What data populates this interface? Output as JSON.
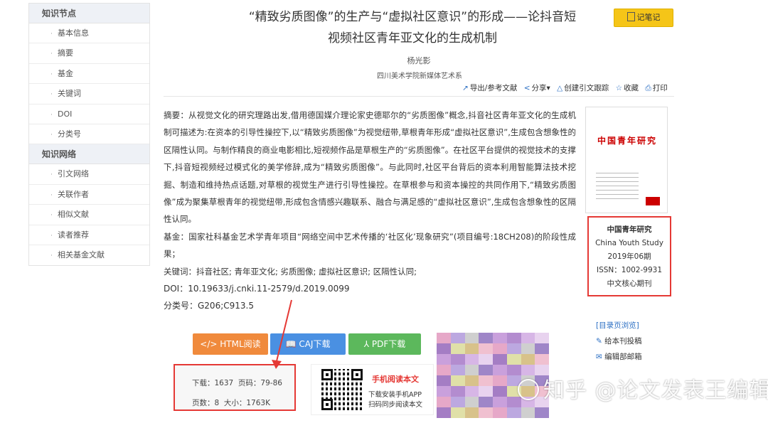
{
  "sidebar": {
    "sections": [
      {
        "heading": "知识节点",
        "items": [
          "基本信息",
          "摘要",
          "基金",
          "关键词",
          "DOI",
          "分类号"
        ]
      },
      {
        "heading": "知识网络",
        "items": [
          "引文网络",
          "关联作者",
          "相似文献",
          "读者推荐",
          "相关基金文献"
        ]
      }
    ]
  },
  "article": {
    "title_line1": "“精致劣质图像”的生产与“虚拟社区意识”的形成——论抖音短",
    "title_line2": "视频社区青年亚文化的生成机制",
    "author": "杨光影",
    "affiliation": "四川美术学院新媒体艺术系",
    "note_button": "记笔记",
    "abstract": "摘要：从视觉文化的研究理路出发,借用德国媒介理论家史德耶尔的“劣质图像”概念,抖音社区青年亚文化的生成机制可描述为:在资本的引导性操控下,以“精致劣质图像”为视觉纽带,草根青年形成“虚拟社区意识”,生成包含想象性的区隔性认同。与制作精良的商业电影相比,短视频作品是草根生产的“劣质图像”。在社区平台提供的视觉技术的支撑下,抖音短视频经过模式化的美学修辞,成为“精致劣质图像”。与此同时,社区平台背后的资本利用智能算法技术挖掘、制造和维持热点话题,对草根的视觉生产进行引导性操控。在草根参与和资本操控的共同作用下,“精致劣质图像”成为聚集草根青年的视觉纽带,形成包含情感兴趣联系、融合与满足感的“虚拟社区意识”,生成包含想象性的区隔性认同。",
    "fund": "基金：国家社科基金艺术学青年项目“网络空间中艺术传播的‘社区化’现象研究”(项目编号:18CH208)的阶段性成果；",
    "keywords": "关键词：抖音社区; 青年亚文化; 劣质图像; 虚拟社区意识; 区隔性认同;",
    "doi": "DOI：10.19633/j.cnki.11-2579/d.2019.0099",
    "classification": "分类号：G206;C913.5"
  },
  "toolbar": {
    "export": "导出/参考文献",
    "share": "分享",
    "track": "创建引文跟踪",
    "collect": "收藏",
    "print": "打印"
  },
  "journal": {
    "cover_text": "中国青年研究",
    "name": "中国青年研究",
    "english": "China Youth Study",
    "issue": "2019年06期",
    "issn": "ISSN：1002-9931",
    "core": "中文核心期刊"
  },
  "right_links": {
    "toc": "[目录页浏览]",
    "submit": "给本刊投稿",
    "editor": "编辑部邮箱"
  },
  "downloads": {
    "html": "HTML阅读",
    "caj": "CAJ下载",
    "pdf": "PDF下载",
    "downloads_text": "下载：1637",
    "pages_text": "页码：79-86",
    "pagecount_text": "页数：8",
    "size_text": "大小：1763K"
  },
  "mobile": {
    "title": "手机阅读本文",
    "line1": "下载安装手机APP",
    "line2": "扫码同步阅读本文"
  },
  "watermark": "知乎 @论文发表王编辑",
  "colors": {
    "note": "#f5c518",
    "html_btn": "#f08a3c",
    "caj_btn": "#4a90e2",
    "pdf_btn": "#5cb85c",
    "highlight": "#e53935"
  }
}
